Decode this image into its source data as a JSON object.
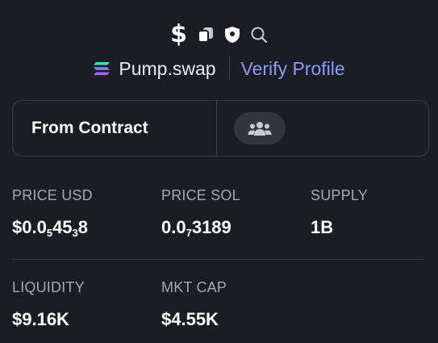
{
  "header": {
    "dollar_symbol": "$",
    "icons": [
      "dollar-icon",
      "copy-icon",
      "shield-icon",
      "search-icon"
    ],
    "dex_name": "Pump.swap",
    "verify_label": "Verify Profile"
  },
  "contract": {
    "label": "From Contract",
    "icon": "users-icon"
  },
  "stats": {
    "price_usd": {
      "label": "PRICE USD",
      "prefix": "$0.0",
      "sub1": "5",
      "mid": "45",
      "sub2": "3",
      "suffix": "8"
    },
    "price_sol": {
      "label": "PRICE SOL",
      "prefix": "0.0",
      "sub1": "7",
      "suffix": "3189"
    },
    "supply": {
      "label": "SUPPLY",
      "value": "1B"
    },
    "liquidity": {
      "label": "LIQUIDITY",
      "value": "$9.16K"
    },
    "mkt_cap": {
      "label": "MKT CAP",
      "value": "$4.55K"
    }
  },
  "colors": {
    "background": "#1c1d22",
    "accent_link": "#8a9bff",
    "label": "#a5a7b4",
    "border": "#393b43"
  }
}
